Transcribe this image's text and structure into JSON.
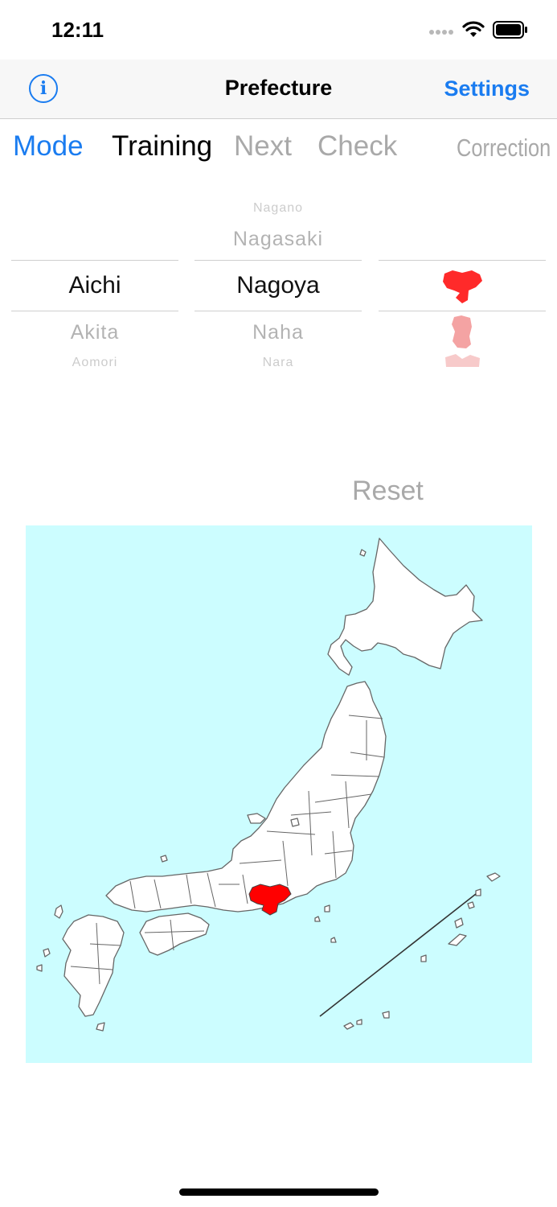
{
  "status_bar": {
    "time": "12:11",
    "icons": [
      "signal-dots-icon",
      "wifi-icon",
      "battery-icon"
    ]
  },
  "nav": {
    "info_icon": "info-icon",
    "info_glyph": "i",
    "title": "Prefecture",
    "settings_label": "Settings",
    "accent_color": "#1a7cf0"
  },
  "toolbar": {
    "mode_label": "Mode",
    "training_label": "Training",
    "next_label": "Next",
    "check_label": "Check",
    "correction_label": "Correction"
  },
  "picker": {
    "prefecture": {
      "above": "",
      "selected": "Aichi",
      "below": "Akita",
      "below2": "Aomori"
    },
    "capital": {
      "above2": "Nagano",
      "above": "Nagasaki",
      "selected": "Nagoya",
      "below": "Naha",
      "below2": "Nara"
    },
    "shape_icons": [
      "aichi-shape-icon",
      "akita-shape-icon",
      "aomori-shape-icon"
    ]
  },
  "reset_label": "Reset",
  "map": {
    "water_color": "#ccfdff",
    "land_color": "#ffffff",
    "highlight_color": "#ff0000",
    "highlighted_prefecture": "Aichi"
  }
}
